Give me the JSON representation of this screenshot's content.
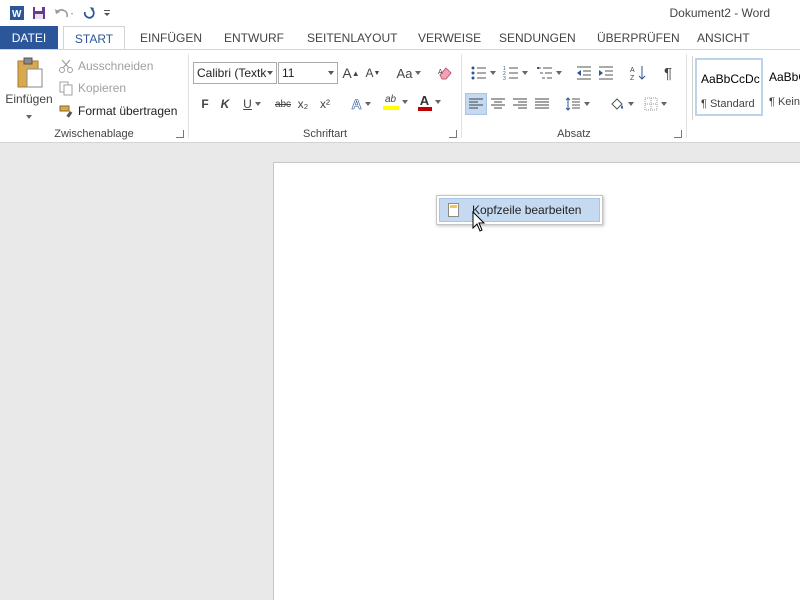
{
  "title_bar": {
    "document_title": "Dokument2 - Word",
    "qat_icons": [
      "word-logo-icon",
      "save-icon",
      "undo-icon",
      "redo-icon",
      "customize-icon"
    ]
  },
  "tabs": [
    {
      "label": "DATEI"
    },
    {
      "label": "START"
    },
    {
      "label": "EINFÜGEN"
    },
    {
      "label": "ENTWURF"
    },
    {
      "label": "SEITENLAYOUT"
    },
    {
      "label": "VERWEISE"
    },
    {
      "label": "SENDUNGEN"
    },
    {
      "label": "ÜBERPRÜFEN"
    },
    {
      "label": "ANSICHT"
    }
  ],
  "ribbon": {
    "clipboard": {
      "paste_label": "Einfügen",
      "cut_label": "Ausschneiden",
      "copy_label": "Kopieren",
      "format_painter_label": "Format übertragen",
      "group_label": "Zwischenablage"
    },
    "font": {
      "font_name": "Calibri (Textk",
      "font_size": "11",
      "grow_label": "A",
      "shrink_label": "A",
      "case_label": "Aa",
      "bold_label": "F",
      "italic_label": "K",
      "underline_label": "U",
      "strike_label": "abc",
      "sub_label": "x₂",
      "sup_label": "x²",
      "effects_label": "A",
      "highlight_label": "ab",
      "color_label": "A",
      "group_label": "Schriftart"
    },
    "paragraph": {
      "show_marks_label": "¶",
      "group_label": "Absatz"
    },
    "styles": {
      "items": [
        {
          "sample": "AaBbCcDc",
          "name": "¶ Standard"
        },
        {
          "sample": "AaBbC",
          "name": "¶ Kein"
        }
      ]
    }
  },
  "context_menu": {
    "items": [
      {
        "label": "Kopfzeile bearbeiten",
        "icon": "page-header-icon"
      }
    ]
  },
  "colors": {
    "accent": "#2b579a",
    "highlight": "#ffff00",
    "font_color": "#c00000",
    "menu_hover": "#c5d9f1"
  }
}
